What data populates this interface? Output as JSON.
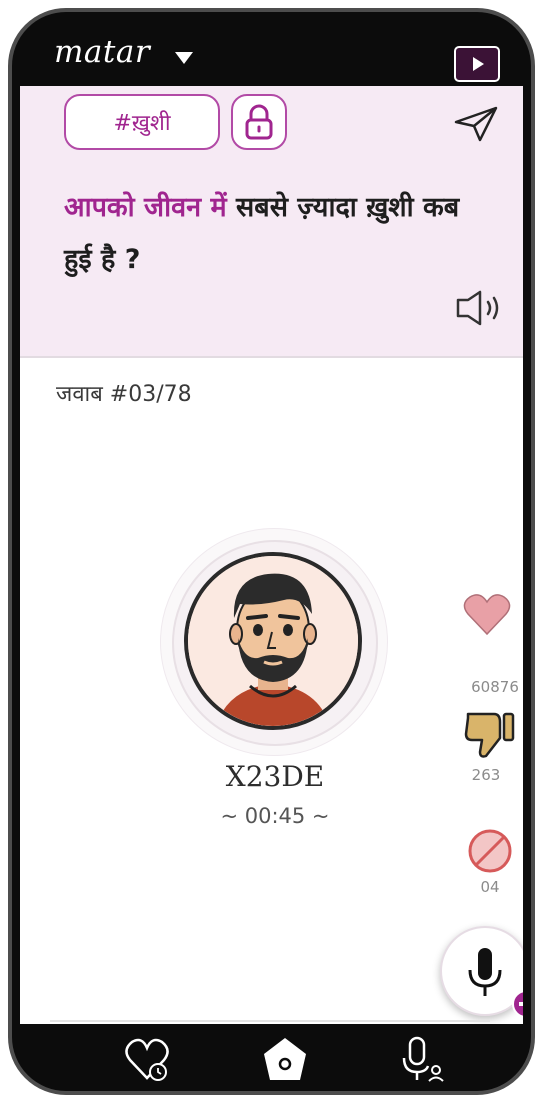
{
  "app": {
    "brand": "matar",
    "brand_menu_icon": "caret-down-icon",
    "play_icon": "play-icon"
  },
  "question_card": {
    "tag": "#ख़ुशी",
    "lock_icon": "lock-icon",
    "share_icon": "send-icon",
    "question_highlight": "आपको जीवन में",
    "question_rest": " सबसे ज़्यादा ख़ुशी कब हुई है ?",
    "speaker_icon": "speaker-icon"
  },
  "answer": {
    "counter": "जवाब #03/78",
    "username": "X23DE",
    "duration": "~ 00:45 ~"
  },
  "actions": {
    "like_count": "60876",
    "dislike_count": "263",
    "block_count": "04"
  },
  "fab": {
    "icon": "mic-add-icon"
  },
  "bottom_nav": {
    "items": [
      "heart-clock-icon",
      "home-icon",
      "mic-user-icon"
    ]
  },
  "colors": {
    "accent": "#a0258f",
    "panel_bg": "#f6eaf4",
    "like": "#e8a0a6",
    "dislike": "#d9b46a",
    "block": "#d65a5a"
  }
}
